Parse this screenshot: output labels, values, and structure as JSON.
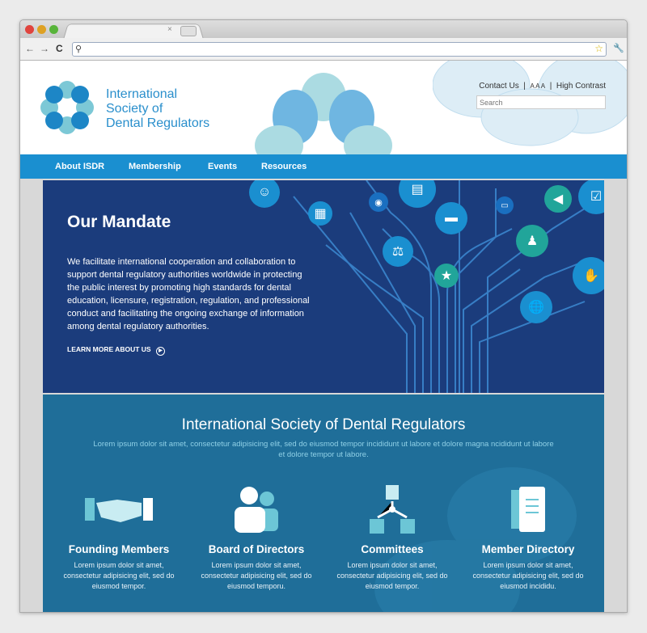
{
  "browser": {
    "close_tab": "×",
    "back": "←",
    "forward": "→",
    "reload": "C",
    "search_glyph": "⚲",
    "star": "☆",
    "wrench": "🔧"
  },
  "header": {
    "org_name_lines": [
      "International",
      "Society of",
      "Dental Regulators"
    ],
    "contact": "Contact Us",
    "sep": "|",
    "text_size": "A A A",
    "high_contrast": "High Contrast",
    "search_placeholder": "Search"
  },
  "nav": {
    "items": [
      "About ISDR",
      "Membership",
      "Events",
      "Resources"
    ]
  },
  "hero": {
    "title": "Our Mandate",
    "body": "We facilitate international cooperation and collaboration to support dental regulatory authorities worldwide in protecting the public interest by promoting high standards for dental education, licensure, registration, regulation, and professional conduct and facilitating the ongoing exchange of information among dental regulatory authorities.",
    "cta": "LEARN MORE ABOUT US",
    "icons": [
      "idea-head-icon",
      "calendar-icon",
      "broadcast-icon",
      "document-icon",
      "chat-icon",
      "scales-icon",
      "star-icon",
      "presentation-icon",
      "megaphone-icon",
      "team-icon",
      "checklist-icon",
      "handshake-icon",
      "globe-icon"
    ]
  },
  "intro": {
    "title": "International Society of Dental Regulators",
    "subtitle": "Lorem ipsum dolor sit amet, consectetur adipisicing elit, sed do eiusmod tempor incididunt ut labore et dolore magna ncididunt ut labore et dolore tempor ut labore."
  },
  "features": [
    {
      "title": "Founding Members",
      "text": "Lorem ipsum dolor sit amet, consectetur adipisicing elit, sed do eiusmod tempor.",
      "icon": "handshake-icon"
    },
    {
      "title": "Board of Directors",
      "text": "Lorem ipsum dolor sit amet, consectetur adipisicing elit, sed do eiusmod temporu.",
      "icon": "people-icon"
    },
    {
      "title": "Committees",
      "text": "Lorem ipsum dolor sit amet, consectetur adipisicing elit, sed do eiusmod tempor.",
      "icon": "org-chart-icon"
    },
    {
      "title": "Member Directory",
      "text": "Lorem ipsum dolor sit amet, consectetur adipisicing elit, sed do eiusmod incididu.",
      "icon": "address-book-icon"
    }
  ],
  "colors": {
    "nav": "#1a8fd0",
    "hero": "#1b3c7c",
    "lower": "#1f6e99",
    "brand_text": "#2a8fcc"
  }
}
